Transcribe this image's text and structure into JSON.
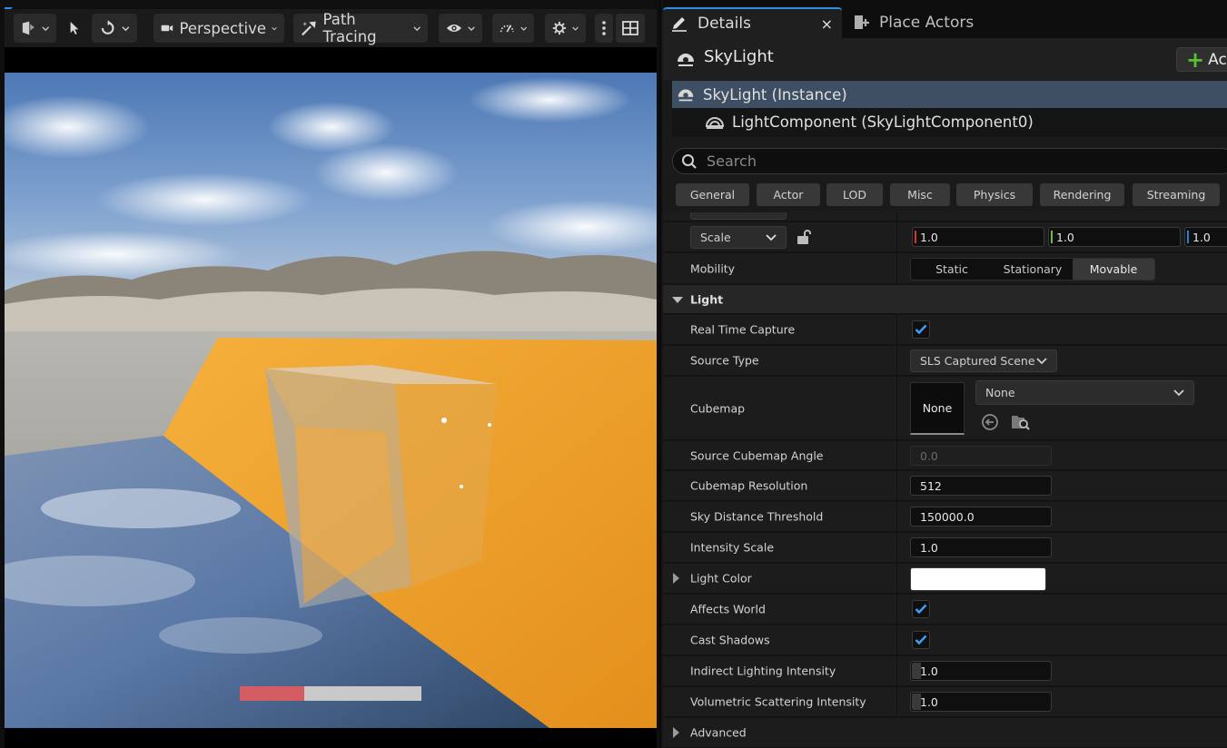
{
  "viewport": {
    "toolbar": {
      "perspective_label": "Perspective",
      "view_mode_label": "Path Tracing"
    },
    "progress": 0.355
  },
  "details": {
    "tabs": [
      {
        "label": "Details"
      },
      {
        "label": "Place Actors"
      }
    ],
    "close_glyph": "×",
    "actor_name": "SkyLight",
    "add_button_label": "Ac",
    "add_button_glyph": "+",
    "components": [
      {
        "label": "SkyLight (Instance)",
        "selected": true
      },
      {
        "label": "LightComponent (SkyLightComponent0)",
        "selected": false
      }
    ],
    "search_placeholder": "Search",
    "filters": [
      "General",
      "Actor",
      "LOD",
      "Misc",
      "Physics",
      "Rendering",
      "Streaming"
    ],
    "transform": {
      "scale_label": "Scale",
      "scale_values": [
        "1.0",
        "1.0",
        "1.0"
      ]
    },
    "mobility": {
      "label": "Mobility",
      "options": [
        "Static",
        "Stationary",
        "Movable"
      ],
      "selected": "Movable"
    },
    "light_category": "Light",
    "rows": {
      "real_time_capture": {
        "label": "Real Time Capture",
        "checked": true
      },
      "source_type": {
        "label": "Source Type",
        "value": "SLS Captured Scene"
      },
      "cubemap": {
        "label": "Cubemap",
        "thumb": "None",
        "value": "None"
      },
      "source_cubemap_angle": {
        "label": "Source Cubemap Angle",
        "value": "0.0"
      },
      "cubemap_resolution": {
        "label": "Cubemap Resolution",
        "value": "512"
      },
      "sky_distance_threshold": {
        "label": "Sky Distance Threshold",
        "value": "150000.0"
      },
      "intensity_scale": {
        "label": "Intensity Scale",
        "value": "1.0"
      },
      "light_color": {
        "label": "Light Color",
        "color": "#ffffff"
      },
      "affects_world": {
        "label": "Affects World",
        "checked": true
      },
      "cast_shadows": {
        "label": "Cast Shadows",
        "checked": true
      },
      "indirect_lighting_intensity": {
        "label": "Indirect Lighting Intensity",
        "value": "1.0"
      },
      "volumetric_scattering_intensity": {
        "label": "Volumetric Scattering Intensity",
        "value": "1.0"
      }
    },
    "advanced_category": "Advanced"
  },
  "colors": {
    "accent": "#2b8fe8",
    "selection": "#3e4f63",
    "checkmark": "#3fa0ff",
    "add_plus": "#57c034",
    "axis_x": "#d03a2e",
    "axis_y": "#6fbf2e",
    "axis_z": "#2f7fd8",
    "progress_fill": "#d35d63"
  }
}
